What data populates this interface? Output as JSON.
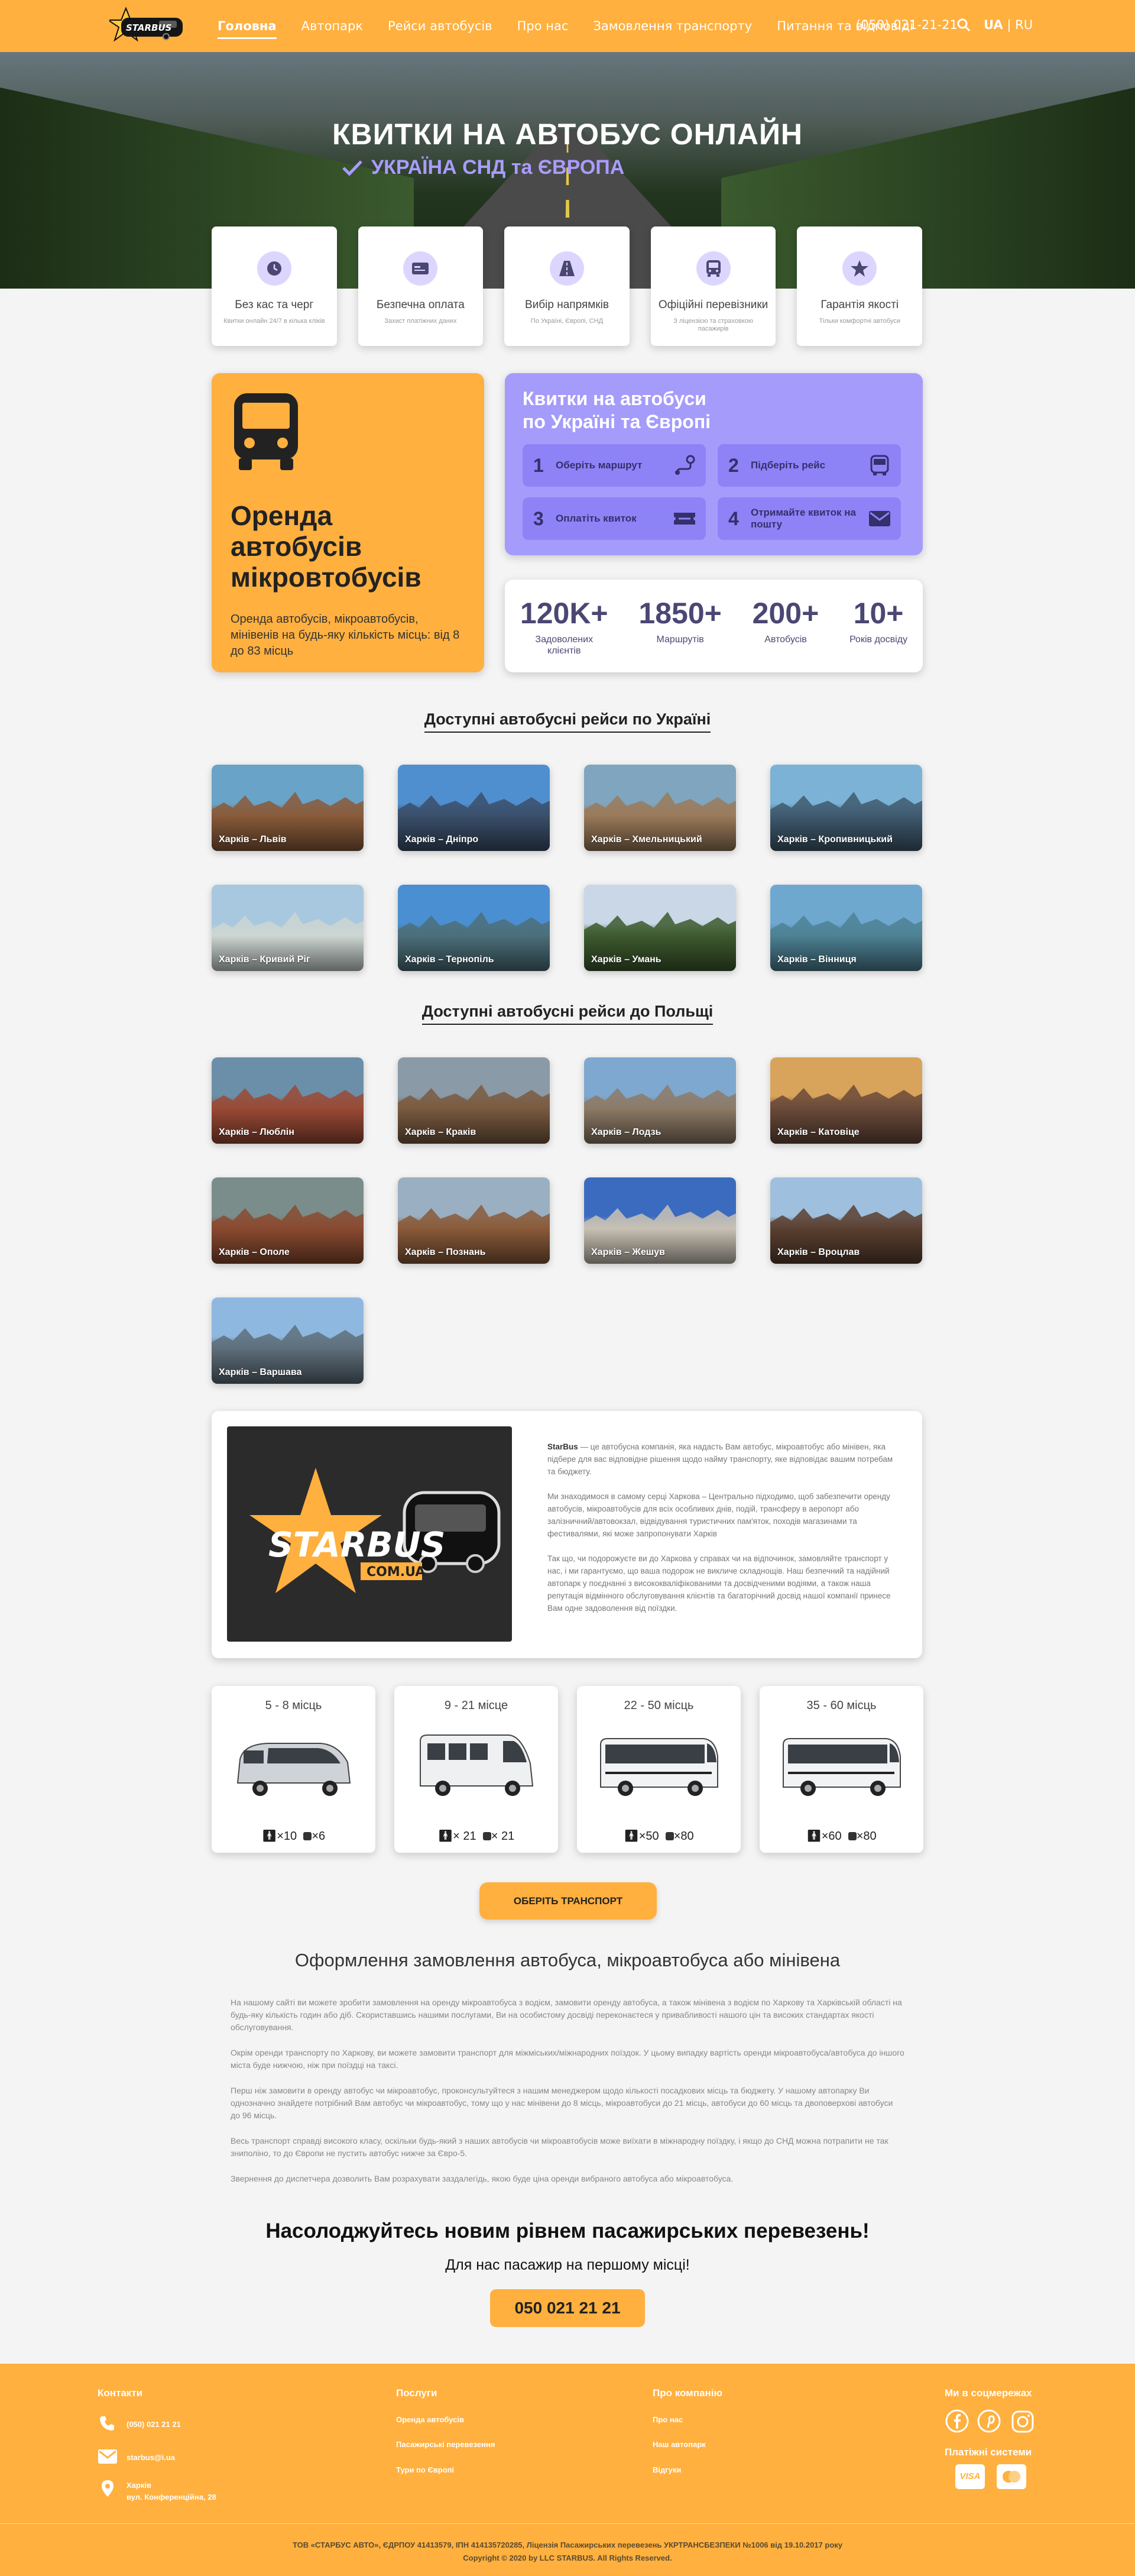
{
  "header": {
    "logo_text": "STARBUS",
    "nav": [
      "Головна",
      "Автопарк",
      "Рейси автобусів",
      "Про нас",
      "Замовлення транспорту",
      "Питання та відповіді"
    ],
    "phone": "(050) 021-21-21",
    "lang_ua": "UA",
    "lang_sep": "|",
    "lang_ru": "RU"
  },
  "hero": {
    "title": "КВИТКИ НА АВТОБУС ОНЛАЙН",
    "subtitle": "УКРАЇНА СНД та ЄВРОПА"
  },
  "features": [
    {
      "icon": "clock-icon",
      "title": "Без кас та черг",
      "desc": "Квитки онлайн 24/7 в кілька кліків"
    },
    {
      "icon": "card-icon",
      "title": "Безпечна оплата",
      "desc": "Захист платіжних даних"
    },
    {
      "icon": "road-icon",
      "title": "Вибір напрямків",
      "desc": "По Україні, Європі, СНД"
    },
    {
      "icon": "bus-icon",
      "title": "Офіційні перевізники",
      "desc": "З ліцензією та страховкою пасажирів"
    },
    {
      "icon": "star-icon",
      "title": "Гарантія якості",
      "desc": "Тільки комфортні автобуси"
    }
  ],
  "rent": {
    "title": "Оренда автобусів мікровтобусів",
    "text": "Оренда автобусів, мікроавтобусів, мінівенів на будь-яку кількість місць: від 8 до 83 місць"
  },
  "tickets": {
    "title_line1": "Квитки на автобуси",
    "title_line2": "по Україні та Європі",
    "steps": [
      {
        "n": "1",
        "label": "Оберіть маршрут",
        "icon": "route-icon"
      },
      {
        "n": "2",
        "label": "Підберіть рейс",
        "icon": "bus-icon"
      },
      {
        "n": "3",
        "label": "Оплатіть квиток",
        "icon": "ticket-icon"
      },
      {
        "n": "4",
        "label": "Отримайте квиток на пошту",
        "icon": "mail-icon"
      }
    ]
  },
  "stats": [
    {
      "value": "120K+",
      "label": "Задоволених клієнтів"
    },
    {
      "value": "1850+",
      "label": "Маршрутів"
    },
    {
      "value": "200+",
      "label": "Автобусів"
    },
    {
      "value": "10+",
      "label": "Років досвіду"
    }
  ],
  "ukraine_section": {
    "title": "Доступні автобусні рейси по Україні",
    "routes": [
      {
        "label": "Харків – Львів",
        "sky": "#6aa3c8",
        "ground": "#8a5b3a"
      },
      {
        "label": "Харків – Дніпро",
        "sky": "#4f8fd0",
        "ground": "#3b4f6b"
      },
      {
        "label": "Харків – Хмельницький",
        "sky": "#7fa5bf",
        "ground": "#9a7a5a"
      },
      {
        "label": "Харків – Кропивницький",
        "sky": "#7cb2d6",
        "ground": "#3f5a6e"
      },
      {
        "label": "Харків – Кривий Ріг",
        "sky": "#a8c8df",
        "ground": "#cdd6d2"
      },
      {
        "label": "Харків – Тернопіль",
        "sky": "#4a8fd1",
        "ground": "#4c6f7a"
      },
      {
        "label": "Харків – Умань",
        "sky": "#c9d7e6",
        "ground": "#3d5a2e"
      },
      {
        "label": "Харків – Вінниця",
        "sky": "#6fa8cf",
        "ground": "#4d8194"
      }
    ]
  },
  "poland_section": {
    "title": "Доступні автобусні рейси до Польщі",
    "routes": [
      {
        "label": "Харків – Люблін",
        "sky": "#6b8fa8",
        "ground": "#9a4a35"
      },
      {
        "label": "Харків – Краків",
        "sky": "#8a9aa6",
        "ground": "#7a5a40"
      },
      {
        "label": "Харків – Лодзь",
        "sky": "#7ea8cf",
        "ground": "#8d7a66"
      },
      {
        "label": "Харків – Катовіце",
        "sky": "#d8a35a",
        "ground": "#6a4a3a"
      },
      {
        "label": "Харків – Ополе",
        "sky": "#7a8d8a",
        "ground": "#8a4a30"
      },
      {
        "label": "Харків – Познань",
        "sky": "#9ab0c2",
        "ground": "#8a5a3a"
      },
      {
        "label": "Харків – Жешув",
        "sky": "#3b6bbf",
        "ground": "#c9c2b5"
      },
      {
        "label": "Харків – Вроцлав",
        "sky": "#9ec0de",
        "ground": "#5a4030"
      },
      {
        "label": "Харків – Варшава",
        "sky": "#8fb8e0",
        "ground": "#5e6e7a"
      }
    ]
  },
  "about": {
    "logo_word": "STARBUS",
    "logo_domain": "COM.UA",
    "brand": "StarBus",
    "p1": " — це автобусна компанія, яка надасть Вам автобус, мікроавтобус або мінівен, яка підбере для вас відповідне рішення щодо найму транспорту, яке відповідає вашим потребам та бюджету.",
    "p2": "Ми знаходимося в самому серці Харкова – Центрально підходимо, щоб забезпечити оренду автобусів, мікроавтобусів для всіх особливих днів, подій, трансферу в аеропорт або залізничний/автовокзал, відвідування туристичних пам'яток, походів магазинами та фестивалями, які може запропонувати Харків",
    "p3": "Так що, чи подорожуєте ви до Харкова у справах чи на відпочинок, замовляйте транспорт у нас, і ми гарантуємо, що ваша подорож не викличе складнощів. Наш безпечний та надійний автопарк у поєднанні з висококваліфікованими та досвідченими водіями, а також наша репутація відмінного обслуговування клієнтів та багаторічний досвід нашої компанії принесе Вам одне задоволення від поїздки."
  },
  "vehicles": [
    {
      "seats": "5 - 8 місць",
      "people": "×10",
      "bags": "×6",
      "kind": "minivan"
    },
    {
      "seats": "9 - 21 місце",
      "people": "× 21",
      "bags": "× 21",
      "kind": "sprinter"
    },
    {
      "seats": "22 - 50 місць",
      "people": "×50",
      "bags": "×80",
      "kind": "coach"
    },
    {
      "seats": "35 - 60 місць",
      "people": "×60",
      "bags": "×80",
      "kind": "coach"
    }
  ],
  "choose_transport": "ОБЕРІТЬ ТРАНСПОРТ",
  "order": {
    "title": "Оформлення замовлення автобуса, мікроавтобуса або мінівена",
    "paragraphs": [
      "На нашому сайті ви можете зробити замовлення на оренду мікроавтобуса з водієм, замовити оренду автобуса, а також мінівена з водієм по Харкову та Харківській області на будь-яку кількість годин або діб. Скориставшись нашими послугами, Ви на особистому досвіді переконаєтеся у привабливості нашого цін та високих стандартах якості обслуговування.",
      "Окрім оренди транспорту по Харкову, ви можете замовити транспорт для міжміських/міжнародних поїздок. У цьому випадку вартість оренди мікроавтобуса/автобуса до іншого міста буде нижчою, ніж при поїздці на таксі.",
      "Перш ніж замовити в оренду автобус чи мікроавтобус, проконсультуйтеся з нашим менеджером щодо кількості посадкових місць та бюджету. У нашому автопарку Ви однозначно знайдете потрібний Вам автобус чи мікроавтобус, тому що у нас мінівени до 8 місць, мікроавтобуси до 21 місць, автобуси до 60 місць та двоповерхові автобуси до 96 місць.",
      "Весь транспорт справді високого класу, оскільки будь-який з наших автобусів чи мікроавтобусів може виїхати в міжнародну поїздку, і якщо до СНД можна потрапити не так зниполіно, то до Європи не пустить автобус нижче за Євро-5.",
      "Звернення до диспетчера дозволить Вам розрахувати заздалегідь, якою буде ціна оренди вибраного автобуса або мікроавтобуса."
    ]
  },
  "cta": {
    "enjoy": "Насолоджуйтесь новим рівнем пасажирських перевезень!",
    "first": "Для нас пасажир на першому місці!",
    "phone": "050 021 21 21"
  },
  "footer": {
    "contacts_title": "Контакти",
    "phone": "(050) 021 21 21",
    "email": "starbus@i.ua",
    "city": "Харків",
    "street": "вул. Конференційна, 28",
    "services_title": "Послуги",
    "services": [
      "Оренда автобусів",
      "Пасажирські перевезення",
      "Тури по Європі"
    ],
    "company_title": "Про компанію",
    "company": [
      "Про нас",
      "Наш автопарк",
      "Відгуки"
    ],
    "social_title": "Ми в соцмережах",
    "pay_title": "Платіжні системи",
    "visa": "VISA",
    "legal1": "ТОВ «СТАРБУС АВТО», ЄДРПОУ 41413579, ІПН 414135720285, Ліцензія Пасажирських перевезень УКРТРАНСБЕЗПЕКИ №1006 від 19.10.2017 року",
    "legal2": "Copyright © 2020 by LLC STARBUS. All Rights Reserved."
  },
  "colors": {
    "accent": "#ffb03f",
    "violet": "#a59bfb",
    "violet_dark": "#4a4773"
  }
}
